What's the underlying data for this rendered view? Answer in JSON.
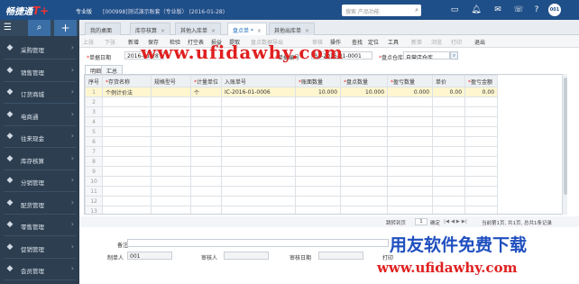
{
  "header": {
    "logo_text": "畅捷通",
    "logo_mark": "T+",
    "edition": "专业版",
    "company": "[000998]测试演示账套（专业版）  (2016-01-28)",
    "search_placeholder": "搜索 产品功能",
    "user": "001"
  },
  "sidebar": {
    "items": [
      {
        "label": "采购管理",
        "icon": "cart-icon"
      },
      {
        "label": "销售管理",
        "icon": "sales-icon"
      },
      {
        "label": "订货商城",
        "icon": "store-icon"
      },
      {
        "label": "电商通",
        "icon": "ecommerce-icon"
      },
      {
        "label": "往来现金",
        "icon": "cash-icon"
      },
      {
        "label": "库存核算",
        "icon": "inventory-icon"
      },
      {
        "label": "分销管理",
        "icon": "distribution-icon"
      },
      {
        "label": "配货管理",
        "icon": "allocation-icon"
      },
      {
        "label": "零售管理",
        "icon": "retail-icon"
      },
      {
        "label": "促销管理",
        "icon": "promotion-icon"
      },
      {
        "label": "会员管理",
        "icon": "member-icon"
      }
    ]
  },
  "tabs": [
    {
      "label": "我的桌面",
      "close": ""
    },
    {
      "label": "库存核算",
      "close": "×"
    },
    {
      "label": "其他入库单",
      "close": "×"
    },
    {
      "label": "盘点单 *",
      "close": "×"
    },
    {
      "label": "其他出库单",
      "close": "×"
    }
  ],
  "toolbar": [
    {
      "label": "上张",
      "disabled": true
    },
    {
      "label": "下张",
      "disabled": true
    },
    {
      "label": "新增",
      "disabled": false
    },
    {
      "label": "保存",
      "disabled": false
    },
    {
      "label": "检验",
      "disabled": false
    },
    {
      "label": "打空表",
      "disabled": false
    },
    {
      "label": "损益",
      "disabled": false
    },
    {
      "label": "提取",
      "disabled": false
    },
    {
      "label": "盘点数据导出",
      "disabled": true
    },
    {
      "label": "审核",
      "disabled": true
    },
    {
      "label": "操作",
      "disabled": false
    },
    {
      "label": "查找",
      "disabled": false
    },
    {
      "label": "定位",
      "disabled": false
    },
    {
      "label": "工具",
      "disabled": false
    },
    {
      "label": "新单",
      "disabled": true
    },
    {
      "label": "浏览",
      "disabled": true
    },
    {
      "label": "打印",
      "disabled": true
    },
    {
      "label": "退出",
      "disabled": false
    }
  ],
  "form": {
    "date_label": "单据日期",
    "date_value": "2016-01-28",
    "code_label": "单据编号",
    "code_value": "BA-2016-01-0001",
    "warehouse_label": "盘点仓库",
    "warehouse_value": "自营店仓库"
  },
  "subtabs": [
    "明细",
    "汇总"
  ],
  "grid": {
    "headers": [
      "序号",
      "存货名称",
      "规格型号",
      "计量单位",
      "入账单号",
      "账面数量",
      "盘点数量",
      "盈亏数量",
      "单价",
      "盈亏金额"
    ],
    "required": [
      false,
      true,
      false,
      true,
      false,
      true,
      true,
      true,
      false,
      true
    ],
    "rows": [
      {
        "no": "1",
        "name": "个例计价法",
        "spec": "",
        "unit": "个",
        "doc": "IC-2016-01-0006",
        "book": "10.000",
        "count": "10.000",
        "diff": "0.000",
        "price": "0.00",
        "amount": "0.00"
      }
    ],
    "empty_rows": [
      "2",
      "3",
      "4",
      "5",
      "6",
      "7",
      "8",
      "9",
      "10",
      "11",
      "12",
      "13"
    ],
    "total": {
      "label": "合计",
      "book": "10.000",
      "count": "10.000",
      "diff": "0.000",
      "amount": "0.00"
    }
  },
  "pager": {
    "goto_label": "跳转到页",
    "page_value": "1",
    "confirm": "确定",
    "info": "当前第1页, 共1页, 总共1条记录"
  },
  "bottom": {
    "memo_label": "备注",
    "maker_label": "制单人",
    "maker_value": "001",
    "auditor_label": "审核人",
    "audit_date_label": "审核日期",
    "print_label": "打印"
  },
  "watermarks": {
    "url1": "www.ufidawhy.com",
    "brand": "用友软件免费下载",
    "url2": "www.ufidawhy.com"
  }
}
